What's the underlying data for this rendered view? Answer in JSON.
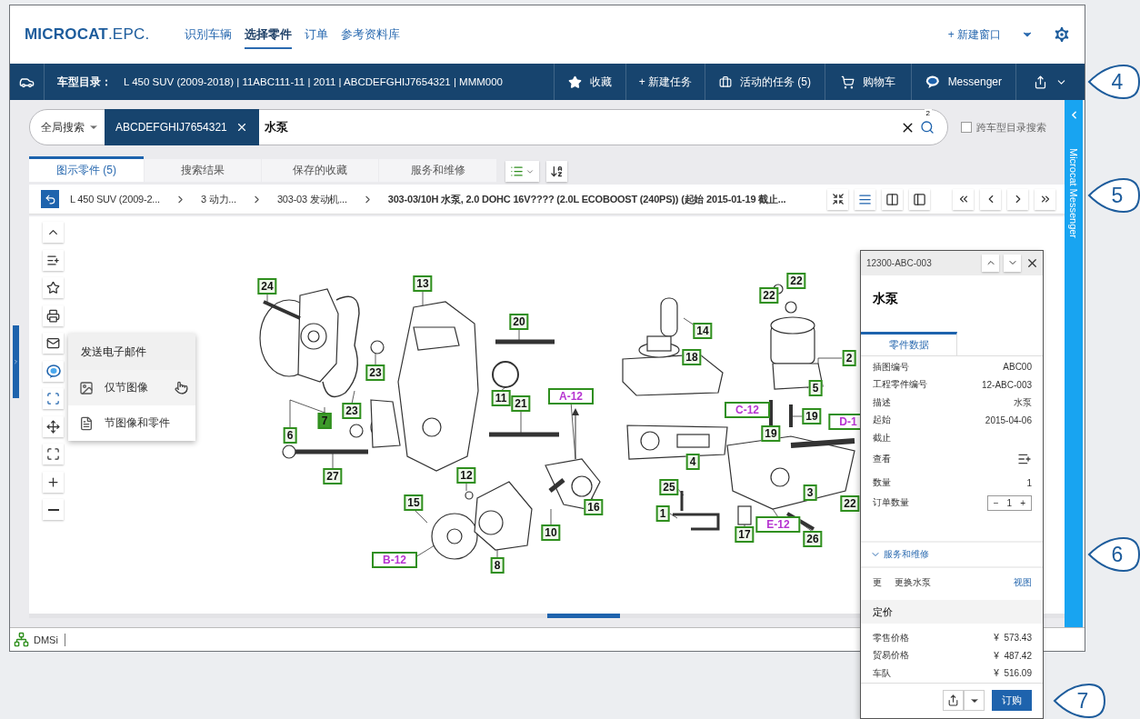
{
  "header": {
    "logo": "**MICROCAT**.EPC.",
    "nav": [
      {
        "label": "识别车辆",
        "selected": false
      },
      {
        "label": "选择零件",
        "selected": true
      },
      {
        "label": "订单",
        "selected": false
      },
      {
        "label": "参考资料库",
        "selected": false
      }
    ],
    "new_window": "+ 新建窗口"
  },
  "vehicle_bar": {
    "label": "车型目录：",
    "info": "L 450 SUV (2009-2018) | 11ABC111-11 | 2011 | ABCDEFGHIJ7654321 | MMM000",
    "actions": [
      {
        "kind": "favorite",
        "label": "收藏"
      },
      {
        "kind": "new-task",
        "label": "+ 新建任务"
      },
      {
        "kind": "tasks",
        "label": "活动的任务 (5)"
      },
      {
        "kind": "cart",
        "label": "购物车"
      },
      {
        "kind": "messenger",
        "label": "Messenger"
      }
    ]
  },
  "search": {
    "scope": "全局搜索",
    "chip": "ABCDEFGHIJ7654321",
    "value": "水泵",
    "badge": "2",
    "cross_catalog": {
      "label": "跨车型目录搜索",
      "checked": false
    }
  },
  "tabs": [
    {
      "label": "图示零件 (5)",
      "selected": true
    },
    {
      "label": "搜索结果",
      "selected": false
    },
    {
      "label": "保存的收藏",
      "selected": false
    },
    {
      "label": "服务和维修",
      "selected": false
    }
  ],
  "breadcrumb": [
    {
      "label": "L 450 SUV (2009-2...",
      "current": false
    },
    {
      "label": "3 动力...",
      "current": false
    },
    {
      "label": "303-03 发动机...",
      "current": false
    },
    {
      "label": "303-03/10H 水泵, 2.0 DOHC 16V???? (2.0L ECOBOOST (240PS)) (起始 2015-01-19 截止...",
      "current": true
    }
  ],
  "email_menu": {
    "title": "发送电子邮件",
    "items": [
      {
        "kind": "image",
        "label": "仅节图像",
        "selected": true
      },
      {
        "kind": "parts",
        "label": "节图像和零件",
        "selected": false
      }
    ]
  },
  "callouts": [
    {
      "label": "24",
      "kind": "part",
      "selected": false
    },
    {
      "label": "13",
      "kind": "part",
      "selected": false
    },
    {
      "label": "22",
      "kind": "part",
      "selected": false
    },
    {
      "label": "22",
      "kind": "part",
      "selected": false
    },
    {
      "label": "20",
      "kind": "part",
      "selected": false
    },
    {
      "label": "14",
      "kind": "part",
      "selected": false
    },
    {
      "label": "18",
      "kind": "part",
      "selected": false
    },
    {
      "label": "2",
      "kind": "part",
      "selected": false
    },
    {
      "label": "23",
      "kind": "part",
      "selected": false
    },
    {
      "label": "5",
      "kind": "part",
      "selected": false
    },
    {
      "label": "A-12",
      "kind": "ref",
      "selected": false
    },
    {
      "label": "11",
      "kind": "part",
      "selected": false
    },
    {
      "label": "21",
      "kind": "part",
      "selected": false
    },
    {
      "label": "C-12",
      "kind": "ref",
      "selected": false
    },
    {
      "label": "23",
      "kind": "part",
      "selected": false
    },
    {
      "label": "19",
      "kind": "part",
      "selected": false
    },
    {
      "label": "7",
      "kind": "part",
      "selected": true
    },
    {
      "label": "D-1",
      "kind": "ref",
      "selected": false
    },
    {
      "label": "19",
      "kind": "part",
      "selected": false
    },
    {
      "label": "6",
      "kind": "part",
      "selected": false
    },
    {
      "label": "4",
      "kind": "part",
      "selected": false
    },
    {
      "label": "12",
      "kind": "part",
      "selected": false
    },
    {
      "label": "27",
      "kind": "part",
      "selected": false
    },
    {
      "label": "25",
      "kind": "part",
      "selected": false
    },
    {
      "label": "3",
      "kind": "part",
      "selected": false
    },
    {
      "label": "15",
      "kind": "part",
      "selected": false
    },
    {
      "label": "22",
      "kind": "part",
      "selected": false
    },
    {
      "label": "16",
      "kind": "part",
      "selected": false
    },
    {
      "label": "1",
      "kind": "part",
      "selected": false
    },
    {
      "label": "E-12",
      "kind": "ref",
      "selected": false
    },
    {
      "label": "10",
      "kind": "part",
      "selected": false
    },
    {
      "label": "17",
      "kind": "part",
      "selected": false
    },
    {
      "label": "26",
      "kind": "part",
      "selected": false
    },
    {
      "label": "B-12",
      "kind": "ref",
      "selected": false
    },
    {
      "label": "8",
      "kind": "part",
      "selected": false
    }
  ],
  "messenger_sidebar": {
    "label": "Microcat Messenger"
  },
  "status_bar": {
    "label": "DMSi"
  },
  "part_panel": {
    "part_number": "12300-ABC-003",
    "title": "水泵",
    "tab": {
      "label": "零件数据",
      "selected": true
    },
    "fields": [
      {
        "kind": "text",
        "label": "插图编号",
        "value": "ABC00"
      },
      {
        "kind": "text",
        "label": "工程零件编号",
        "value": "12-ABC-003"
      },
      {
        "kind": "text",
        "label": "描述",
        "value": "水泵"
      },
      {
        "kind": "text",
        "label": "起始",
        "value": "2015-04-06"
      },
      {
        "kind": "text",
        "label": "截止"
      },
      {
        "kind": "icon",
        "label": "查看"
      },
      {
        "kind": "text",
        "label": "数量",
        "value": "1"
      },
      {
        "kind": "stepper",
        "label": "订单数量",
        "value": "1",
        "minus": "−",
        "plus": "+"
      }
    ],
    "service": {
      "label": "服务和维修",
      "expanded": true,
      "rows": [
        {
          "code": "更",
          "description": "更换水泵",
          "link": "视图"
        }
      ]
    },
    "pricing": {
      "title": "定价",
      "rows": [
        {
          "label": "零售价格",
          "currency": "¥",
          "amount": "573.43"
        },
        {
          "label": "贸易价格",
          "currency": "¥",
          "amount": "487.42"
        },
        {
          "label": "车队",
          "currency": "¥",
          "amount": "516.09"
        }
      ]
    },
    "order_button": "订购"
  },
  "annotations": [
    "4",
    "5",
    "6",
    "7"
  ]
}
